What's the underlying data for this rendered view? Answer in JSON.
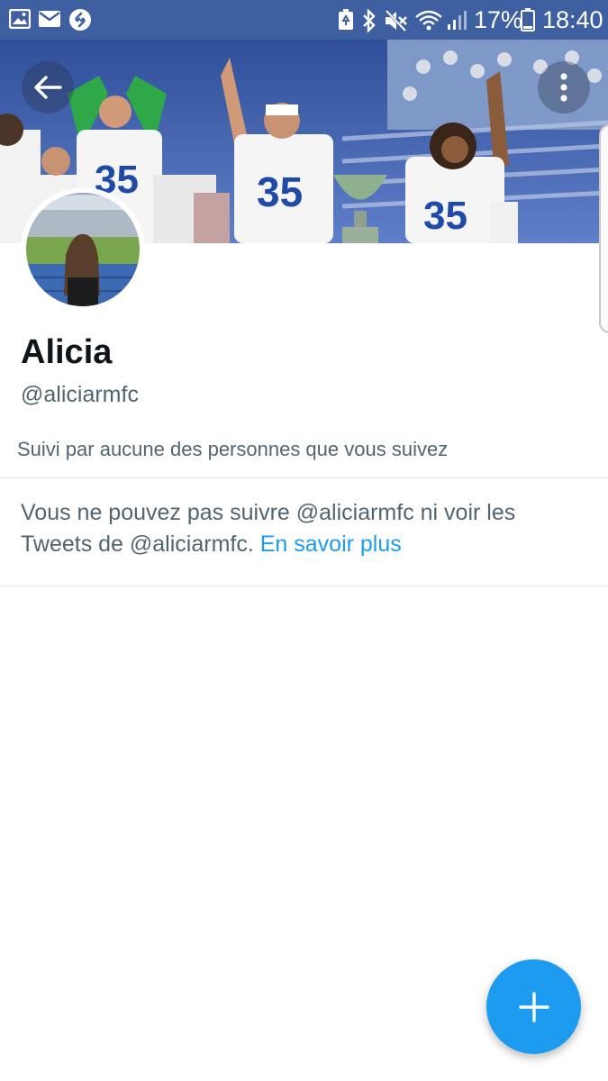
{
  "status_bar": {
    "time": "18:40",
    "battery_percent": "17%",
    "left_icons": [
      "gallery-icon",
      "mail-icon",
      "shazam-icon"
    ],
    "right_icons": [
      "battery-saver-icon",
      "bluetooth-icon",
      "mute-icon",
      "wifi-icon",
      "signal-icon",
      "battery-icon"
    ]
  },
  "header": {
    "back_icon": "arrow-left-icon",
    "more_icon": "more-vertical-icon"
  },
  "profile": {
    "name": "Alicia",
    "handle": "@aliciarmfc",
    "followed_by": "Suivi par aucune des personnes que vous suivez"
  },
  "notice": {
    "text": "Vous ne pouvez pas suivre @aliciarmfc ni voir les Tweets de @aliciarmfc.",
    "link": "En savoir plus"
  },
  "fab": {
    "icon": "plus-icon"
  },
  "colors": {
    "status_bar": "#3e5fa0",
    "accent": "#1d9bf0",
    "text_primary": "#0f1419",
    "text_secondary": "#536471"
  }
}
